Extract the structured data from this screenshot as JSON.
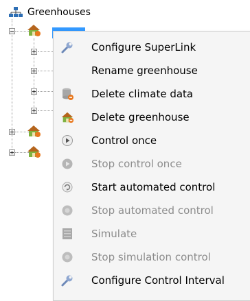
{
  "tree": {
    "root_label": "Greenhouses"
  },
  "menu": {
    "items": [
      {
        "label": "Configure SuperLink",
        "icon": "wrench-icon",
        "enabled": true
      },
      {
        "label": "Rename greenhouse",
        "icon": "",
        "enabled": true
      },
      {
        "label": "Delete climate data",
        "icon": "database-delete-icon",
        "enabled": true
      },
      {
        "label": "Delete greenhouse",
        "icon": "greenhouse-delete-icon",
        "enabled": true
      },
      {
        "label": "Control once",
        "icon": "play-icon",
        "enabled": true
      },
      {
        "label": "Stop control once",
        "icon": "stop-play-icon",
        "enabled": false
      },
      {
        "label": "Start automated control",
        "icon": "auto-control-icon",
        "enabled": true
      },
      {
        "label": "Stop automated control",
        "icon": "stop-auto-icon",
        "enabled": false
      },
      {
        "label": "Simulate",
        "icon": "simulate-icon",
        "enabled": false
      },
      {
        "label": "Stop simulation control",
        "icon": "stop-simulation-icon",
        "enabled": false
      },
      {
        "label": "Configure Control Interval",
        "icon": "wrench-icon",
        "enabled": true
      }
    ]
  },
  "colors": {
    "selection": "#3399ff",
    "menu_bg": "#f5f5f5",
    "disabled_text": "#8c8c8c",
    "greenhouse_orange": "#e8781e"
  }
}
